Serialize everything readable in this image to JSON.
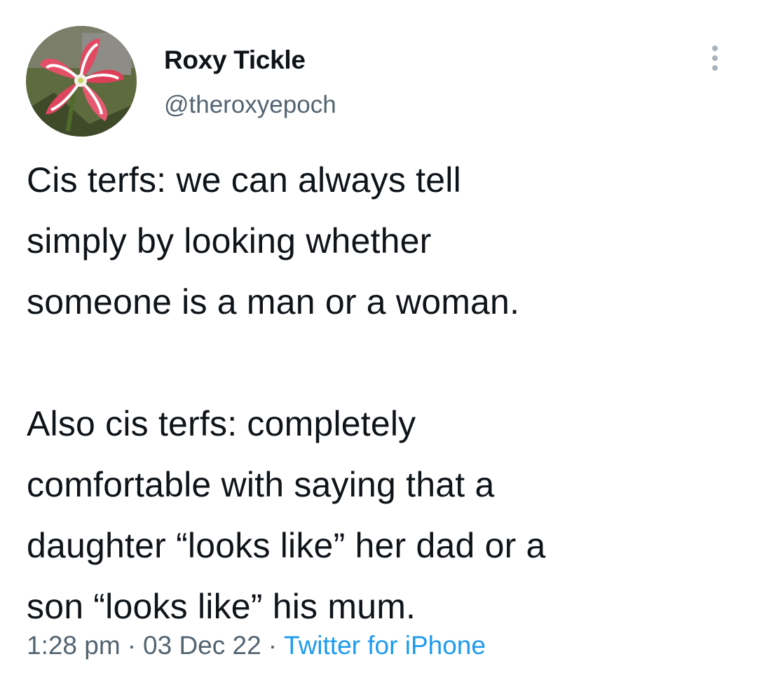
{
  "author": {
    "display_name": "Roxy Tickle",
    "handle": "@theroxyepoch",
    "avatar_icon": "amaryllis-flower-avatar"
  },
  "more_icon": "more-horizontal-icon",
  "tweet": {
    "paragraphs": [
      "Cis terfs: we can always tell\nsimply by looking whether\nsomeone is a man or a woman.",
      "Also cis terfs: completely\ncomfortable with saying that a\ndaughter “looks like” her dad or a\nson “looks like” his mum."
    ]
  },
  "meta": {
    "time": "1:28 pm",
    "separator": "·",
    "date": "03 Dec 22",
    "source": "Twitter for iPhone"
  },
  "colors": {
    "text": "#0f1419",
    "secondary_text": "#536471",
    "link": "#1d9bf0"
  }
}
